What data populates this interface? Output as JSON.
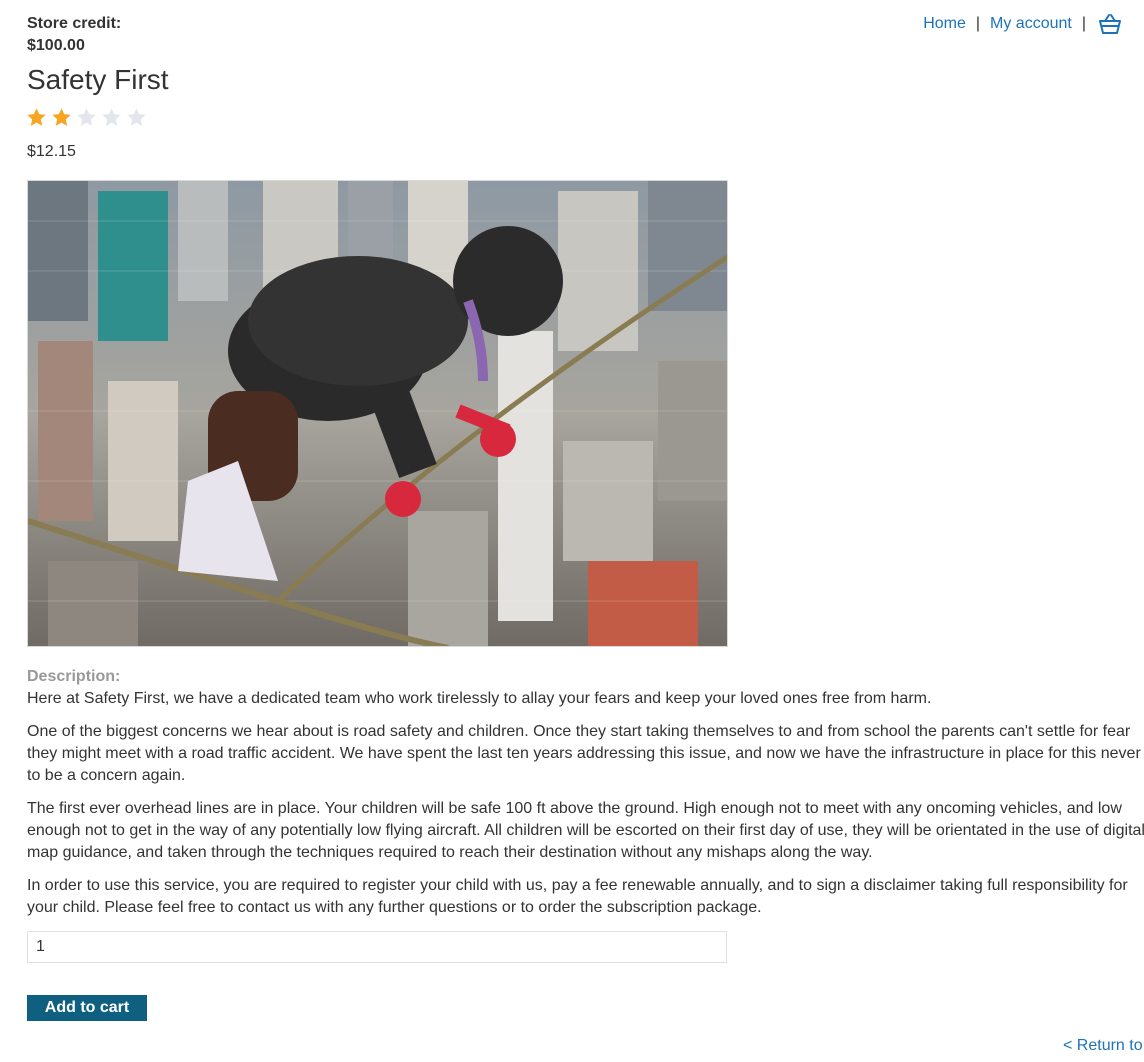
{
  "store_credit": {
    "label": "Store credit:",
    "amount": "$100.00"
  },
  "nav": {
    "home": "Home",
    "separator": "|",
    "account": "My account",
    "cart_icon": "basket-icon"
  },
  "product": {
    "title": "Safety First",
    "rating": {
      "value": 2,
      "max": 5
    },
    "price": "$12.15",
    "image": {
      "icon": "product-image",
      "alt": ""
    },
    "description_label": "Description:",
    "description": [
      "Here at Safety First, we have a dedicated team who work tirelessly to allay your fears and keep your loved ones free from harm.",
      "One of the biggest concerns we hear about is road safety and children. Once they start taking themselves to and from school the parents can't settle for fear they might meet with a road traffic accident. We have spent the last ten years addressing this issue, and now we have the infrastructure in place for this never to be a concern again.",
      "The first ever overhead lines are in place. Your children will be safe 100 ft above the ground. High enough not to meet with any oncoming vehicles, and low enough not to get in the way of any potentially low flying aircraft. All children will be escorted on their first day of use, they will be orientated in the use of digital map guidance, and taken through the techniques required to reach their destination without any mishaps along the way.",
      "In order to use this service, you are required to register your child with us, pay a fee renewable annually, and to sign a disclaimer taking full responsibility for your child. Please feel free to contact us with any further questions or to order the subscription package."
    ]
  },
  "cart_form": {
    "quantity": "1",
    "button_label": "Add to cart"
  },
  "footer": {
    "return_link": "< Return to list"
  },
  "colors": {
    "link": "#1d73b8",
    "button": "#0e5f80",
    "star_filled": "#f5a623",
    "star_empty": "#e3e6ea",
    "label_muted": "#999999"
  }
}
